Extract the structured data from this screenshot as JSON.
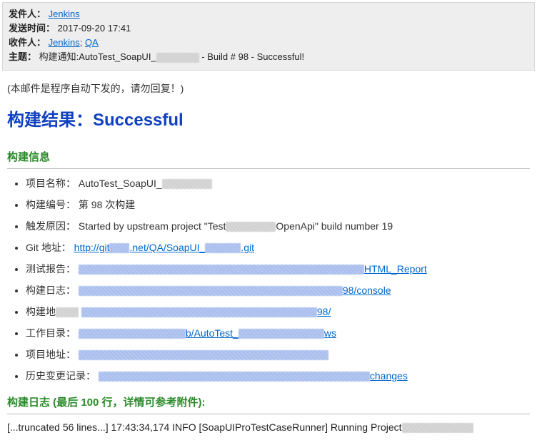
{
  "meta": {
    "from_label": "发件人：",
    "from_link": "Jenkins",
    "senttime_label": "发送时间：",
    "senttime_value": "2017-09-20 17:41",
    "to_label": "收件人：",
    "to_link1": "Jenkins",
    "to_sep": "; ",
    "to_link2": "QA",
    "subject_label": "主题：",
    "subject_value_pre": "构建通知:AutoTest_SoapUI_",
    "subject_value_post": " - Build # 98 - Successful!"
  },
  "body": {
    "auto_note": "(本邮件是程序自动下发的，请勿回复！)",
    "result_title": "构建结果：Successful",
    "info_section": "构建信息",
    "log_section": "构建日志 (最后 100 行，详情可参考附件):"
  },
  "info": {
    "project_label": "项目名称：",
    "project_value": "AutoTest_SoapUI_",
    "buildno_label": "构建编号：",
    "buildno_value": "第 98 次构建",
    "cause_label": "触发原因：",
    "cause_pre": "Started by upstream project \"Test",
    "cause_post": "OpenApi\" build number 19",
    "git_label": "Git 地址：",
    "git_url_pre": "http://git",
    "git_url_mid": ".net/QA/SoapUI_",
    "git_url_post": ".git",
    "report_label": "测试报告：",
    "report_link_tail": "HTML_Report",
    "buildlog_label": "构建日志：",
    "buildlog_link_tail": "98/console",
    "buildurl_label": "构建地",
    "buildurl_link_tail": "98/",
    "workdir_label": "工作目录：",
    "workdir_link_mid": "b/AutoTest_",
    "workdir_link_tail": "ws",
    "projurl_label": "项目地址：",
    "changes_label": "历史变更记录：",
    "changes_link_tail": "changes"
  },
  "log": {
    "line1": "[...truncated 56 lines...] 17:43:34,174 INFO [SoapUIProTestCaseRunner] Running Project"
  }
}
